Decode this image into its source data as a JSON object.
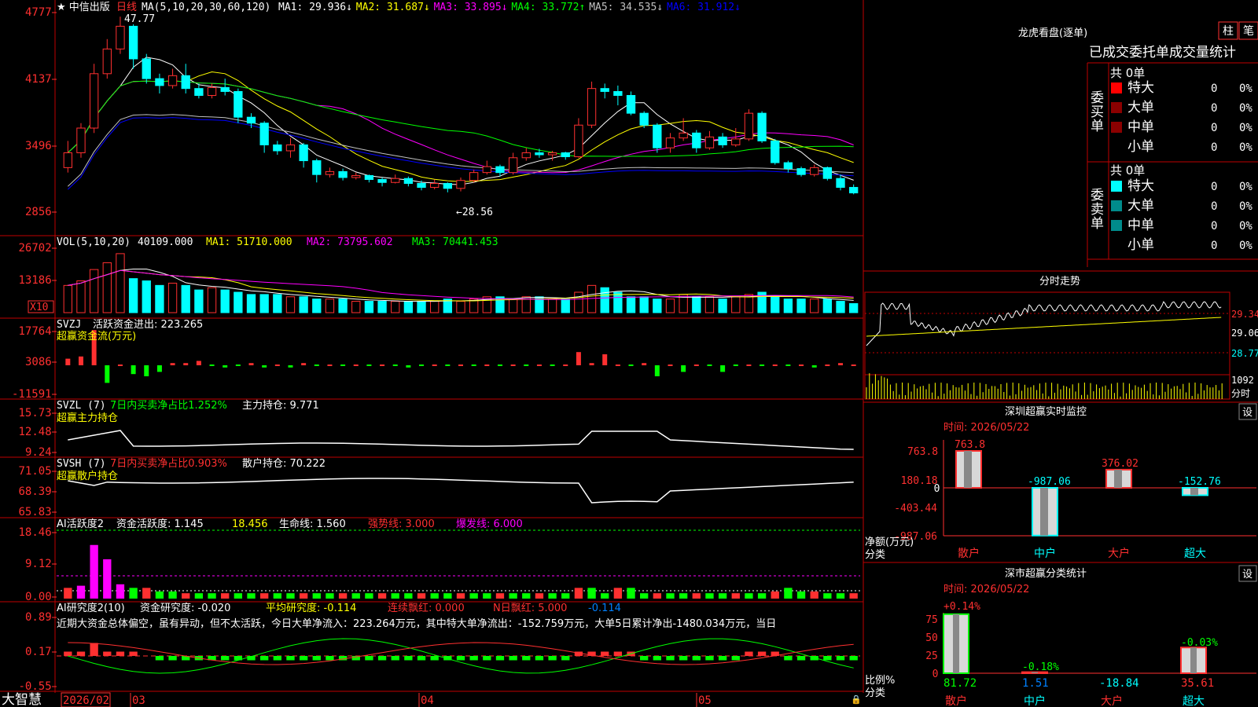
{
  "header": {
    "stock_name": "中信出版",
    "period": "日线",
    "ma_label": "MA(5,10,20,30,60,120)",
    "ma_values": [
      {
        "label": "MA1: 29.936",
        "arrow": "↓",
        "color": "#ffffff"
      },
      {
        "label": "MA2: 31.687",
        "arrow": "↓",
        "color": "#ffff00"
      },
      {
        "label": "MA3: 33.895",
        "arrow": "↓",
        "color": "#ff00ff"
      },
      {
        "label": "MA4: 33.772",
        "arrow": "↑",
        "color": "#00ff00"
      },
      {
        "label": "MA5: 34.535",
        "arrow": "↓",
        "color": "#c0c0c0"
      },
      {
        "label": "MA6: 31.912",
        "arrow": "↓",
        "color": "#0000ff"
      }
    ],
    "high_mark": "47.77",
    "low_mark": "←28.56"
  },
  "price_axis": [
    "4777",
    "4137",
    "3496",
    "2856"
  ],
  "vol_panel": {
    "title": "VOL(5,10,20)",
    "value": "40109.000",
    "ma1": "MA1: 51710.000",
    "ma2": "MA2: 73795.602",
    "ma3": "MA3: 70441.453",
    "axis": [
      "26702",
      "13186"
    ],
    "unit": "X10"
  },
  "svzj_panel": {
    "title": "SVZJ",
    "label": "活跃资金进出: 223.265",
    "subtitle": "超赢资金流(万元)",
    "axis": [
      "17764",
      "3086",
      "-11591"
    ]
  },
  "svzl_panel": {
    "title": "SVZL (7)",
    "label1": "7日内买卖净占比1.252%",
    "label2": "主力持仓: 9.771",
    "subtitle": "超赢主力持仓",
    "axis": [
      "15.73",
      "12.48",
      "9.24"
    ]
  },
  "svsh_panel": {
    "title": "SVSH (7)",
    "label1": "7日内买卖净占比0.903%",
    "label2": "散户持仓: 70.222",
    "subtitle": "超赢散户持仓",
    "axis": [
      "71.05",
      "68.39",
      "65.83"
    ]
  },
  "ai_active_panel": {
    "title": "AI活跃度2",
    "label1": "资金活跃度: 1.145",
    "label2": "18.456",
    "label3": "生命线: 1.560",
    "label4": "强势线: 3.000",
    "label5": "爆发线: 6.000",
    "axis": [
      "18.46",
      "9.12",
      "0.00"
    ]
  },
  "ai_research_panel": {
    "title": "AI研究度2(10)",
    "label1": "资金研究度: -0.020",
    "label2": "平均研究度: -0.114",
    "label3": "连续飘红: 0.000",
    "label4": "N日飘红: 5.000",
    "label5": "-0.114",
    "comment": "近期大资金总体偏空，虽有异动，但不太活跃，今日大单净流入：223.264万元，其中特大单净流出：-152.759万元，大单5日累计净出-1480.034万元，当日",
    "axis": [
      "0.89",
      "0.17",
      "-0.55"
    ]
  },
  "bottom_bar": {
    "brand": "大智慧",
    "dates": [
      "2026/02",
      "03",
      "04",
      "05"
    ]
  },
  "dragon_tiger": {
    "title": "龙虎看盘(逐单)",
    "btn1": "柱",
    "btn2": "笔",
    "subtitle": "已成交委托单成交量统计",
    "buy_label": "委买单",
    "sell_label": "委卖单",
    "buy_total": "共 0单",
    "sell_total": "共 0单",
    "rows": [
      {
        "name": "特大",
        "qty": "0",
        "pct": "0%"
      },
      {
        "name": "大单",
        "qty": "0",
        "pct": "0%"
      },
      {
        "name": "中单",
        "qty": "0",
        "pct": "0%"
      },
      {
        "name": "小单",
        "qty": "0",
        "pct": "0%"
      }
    ],
    "colors": {
      "buy": [
        "#ff0000",
        "#8b0000",
        "#8b0000",
        "#000000"
      ],
      "sell": [
        "#00ffff",
        "#008b8b",
        "#008b8b",
        "#000000"
      ]
    }
  },
  "intraday": {
    "title": "分时走势",
    "axis": [
      "29.34",
      "29.06",
      "28.77",
      "1092",
      "分时"
    ]
  },
  "sz_monitor": {
    "title": "深圳超赢实时监控",
    "btn": "设",
    "time": "时间: 2026/05/22",
    "axis": [
      "763.8",
      "180.18",
      "0",
      "-403.44",
      "-987.06"
    ],
    "ylabel1": "净额(万元)",
    "ylabel2": "分类",
    "cats": [
      "散户",
      "中户",
      "大户",
      "超大"
    ],
    "values": [
      763.8,
      -987.06,
      376.02,
      -152.76
    ],
    "value_labels": [
      "763.8",
      "-987.06",
      "376.02",
      "-152.76"
    ]
  },
  "sz_class": {
    "title": "深市超赢分类统计",
    "btn": "设",
    "time": "时间: 2026/05/22",
    "axis": [
      "75",
      "50",
      "25",
      "0"
    ],
    "ylabel1": "比例%",
    "ylabel2": "分类",
    "cats": [
      "散户",
      "中户",
      "大户",
      "超大"
    ],
    "top_labels": [
      "+0.14%",
      "-0.18%",
      "",
      "-0.03%"
    ],
    "bottom_values": [
      "81.72",
      "1.51",
      "-18.84",
      "35.61"
    ],
    "bar_values": [
      81.72,
      1.51,
      0,
      35.61
    ]
  },
  "chart_data": {
    "type": "candlestick",
    "title": "中信出版 日线",
    "ylim": [
      28.0,
      48.5
    ],
    "candles": [
      [
        32.5,
        34.0,
        35.2,
        32.0
      ],
      [
        34.0,
        36.5,
        37.0,
        33.5
      ],
      [
        36.5,
        42.0,
        43.0,
        36.0
      ],
      [
        42.0,
        44.5,
        45.5,
        41.5
      ],
      [
        44.5,
        46.8,
        47.77,
        44.0
      ],
      [
        46.8,
        43.5,
        47.0,
        42.5
      ],
      [
        43.5,
        41.5,
        44.0,
        41.0
      ],
      [
        41.5,
        40.8,
        42.0,
        40.0
      ],
      [
        40.8,
        41.8,
        42.5,
        40.5
      ],
      [
        41.8,
        40.5,
        43.0,
        40.0
      ],
      [
        40.5,
        39.8,
        41.0,
        39.5
      ],
      [
        39.8,
        40.6,
        41.0,
        39.5
      ],
      [
        40.6,
        40.2,
        41.5,
        39.8
      ],
      [
        40.2,
        37.6,
        40.5,
        37.0
      ],
      [
        37.6,
        37.0,
        38.0,
        36.5
      ],
      [
        37.0,
        34.8,
        37.2,
        34.0
      ],
      [
        34.8,
        34.2,
        35.2,
        33.8
      ],
      [
        34.2,
        34.8,
        35.5,
        33.5
      ],
      [
        34.8,
        33.2,
        35.0,
        32.5
      ],
      [
        33.2,
        31.8,
        33.4,
        31.0
      ],
      [
        31.8,
        32.1,
        32.5,
        31.5
      ],
      [
        32.1,
        31.5,
        32.4,
        31.2
      ],
      [
        31.5,
        31.7,
        32.0,
        31.3
      ],
      [
        31.7,
        31.3,
        31.8,
        31.0
      ],
      [
        31.3,
        31.0,
        31.5,
        30.6
      ],
      [
        31.0,
        31.4,
        31.8,
        30.9
      ],
      [
        31.4,
        30.9,
        31.6,
        30.6
      ],
      [
        30.9,
        30.5,
        31.2,
        30.2
      ],
      [
        30.5,
        30.9,
        31.3,
        30.3
      ],
      [
        30.9,
        30.4,
        31.0,
        30.0
      ],
      [
        30.4,
        31.2,
        31.5,
        30.1
      ],
      [
        31.2,
        32.0,
        32.3,
        31.0
      ],
      [
        32.0,
        32.6,
        33.2,
        31.8
      ],
      [
        32.6,
        32.0,
        32.8,
        31.6
      ],
      [
        32.0,
        33.5,
        34.0,
        31.8
      ],
      [
        33.5,
        34.0,
        34.5,
        33.2
      ],
      [
        34.0,
        33.8,
        34.4,
        33.5
      ],
      [
        33.8,
        34.0,
        34.2,
        33.2
      ],
      [
        34.0,
        33.6,
        34.1,
        33.3
      ],
      [
        33.6,
        36.8,
        37.5,
        33.5
      ],
      [
        36.8,
        40.5,
        41.2,
        36.5
      ],
      [
        40.5,
        40.2,
        41.0,
        39.5
      ],
      [
        40.2,
        39.8,
        40.8,
        38.8
      ],
      [
        39.8,
        38.0,
        40.2,
        37.8
      ],
      [
        38.0,
        36.8,
        38.2,
        36.5
      ],
      [
        36.8,
        34.5,
        37.0,
        34.0
      ],
      [
        34.5,
        35.5,
        36.0,
        34.0
      ],
      [
        35.5,
        36.0,
        37.5,
        35.2
      ],
      [
        36.0,
        34.5,
        36.3,
        34.0
      ],
      [
        34.5,
        35.6,
        36.2,
        34.3
      ],
      [
        35.6,
        34.8,
        36.0,
        34.5
      ],
      [
        34.8,
        35.4,
        36.5,
        34.6
      ],
      [
        35.4,
        38.0,
        38.4,
        35.2
      ],
      [
        38.0,
        35.2,
        38.2,
        35.0
      ],
      [
        35.2,
        33.0,
        35.4,
        32.8
      ],
      [
        33.0,
        32.4,
        33.2,
        32.0
      ],
      [
        32.4,
        31.8,
        32.6,
        31.6
      ],
      [
        31.8,
        32.5,
        32.8,
        31.6
      ],
      [
        32.5,
        31.4,
        32.6,
        31.2
      ],
      [
        31.4,
        30.5,
        31.8,
        30.2
      ],
      [
        30.5,
        29.94,
        30.8,
        29.8
      ]
    ],
    "volume": [
      12,
      14,
      19,
      22,
      26,
      15,
      14,
      12,
      13,
      12,
      10,
      11,
      10,
      9,
      8,
      8,
      8,
      7,
      7,
      6,
      6,
      6,
      5,
      5,
      5,
      5,
      5,
      5,
      5,
      6,
      5,
      6,
      7,
      7,
      6,
      7,
      7,
      6,
      6,
      9,
      12,
      11,
      9,
      7,
      7,
      6,
      6,
      8,
      7,
      7,
      6,
      7,
      8,
      9,
      7,
      6,
      6,
      6,
      6,
      5,
      4
    ],
    "svzj": [
      3,
      4,
      16,
      -8,
      0,
      -4,
      -5,
      -3,
      1,
      1,
      2,
      0,
      -1,
      0,
      1,
      -1,
      0,
      -1,
      1,
      0,
      0,
      0,
      0,
      0,
      0,
      0,
      -1,
      0,
      0,
      0,
      0,
      0,
      0,
      0,
      0,
      0,
      0,
      0,
      0,
      6,
      1,
      5,
      0,
      0,
      1,
      -5,
      0,
      -3,
      0,
      0,
      -3,
      0,
      0,
      0,
      0,
      0,
      0,
      -1,
      0,
      1,
      0
    ],
    "ai_active": [
      3,
      3.6,
      15,
      11,
      4,
      3,
      3,
      2,
      2,
      1.5,
      1.5,
      1.5,
      1.5,
      1.5,
      1.5,
      1.5,
      1.5,
      1.5,
      1.5,
      1.5,
      1.5,
      1.5,
      1.5,
      1.5,
      1.5,
      1.5,
      1.5,
      1.5,
      1.5,
      1.5,
      1.5,
      1.5,
      1.5,
      1.5,
      1.5,
      1.5,
      1.5,
      1.5,
      1.5,
      3,
      3,
      1.5,
      3,
      3,
      1.5,
      1.5,
      1.5,
      1.5,
      1.5,
      1.5,
      1.5,
      1.5,
      1.5,
      1.5,
      2,
      3,
      2,
      2,
      1.5,
      1.5,
      1.5
    ],
    "ai_research": [
      0.05,
      0.05,
      0.15,
      0.05,
      0.05,
      0.05,
      0,
      -0.05,
      -0.05,
      -0.05,
      -0.05,
      -0.05,
      -0.05,
      -0.05,
      -0.05,
      -0.05,
      -0.05,
      -0.05,
      -0.05,
      -0.05,
      -0.05,
      -0.05,
      -0.05,
      -0.05,
      -0.05,
      -0.05,
      -0.05,
      -0.05,
      -0.05,
      -0.05,
      -0.05,
      -0.05,
      -0.05,
      -0.05,
      -0.05,
      -0.05,
      -0.05,
      -0.05,
      -0.05,
      0.05,
      0.05,
      0.05,
      0.05,
      0.05,
      -0.05,
      -0.05,
      -0.05,
      -0.05,
      -0.05,
      -0.05,
      -0.05,
      -0.05,
      0.05,
      0.05,
      0.05,
      -0.05,
      -0.05,
      -0.05,
      -0.05,
      -0.05,
      -0.05
    ]
  }
}
